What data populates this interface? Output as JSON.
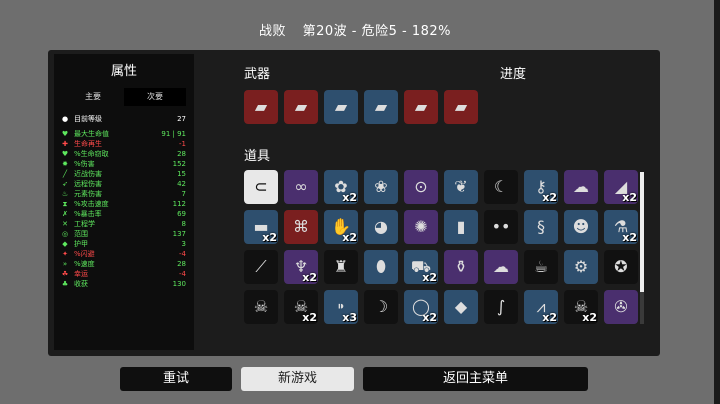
{
  "header": {
    "result": "战败",
    "wave": "第20波 - 危险5 - 182%"
  },
  "stats": {
    "title": "属性",
    "tabs": [
      "主要",
      "次要"
    ],
    "rows": [
      {
        "icon": "level-icon",
        "glyph": "●",
        "name": "目前等级",
        "value": "27",
        "color": "#ffffff"
      },
      {
        "icon": "heart-icon",
        "glyph": "♥",
        "name": "最大生命值",
        "value": "91 | 91",
        "color": "#5ee85e"
      },
      {
        "icon": "regen-icon",
        "glyph": "✚",
        "name": "生命再生",
        "value": "-1",
        "color": "#ff4a4a"
      },
      {
        "icon": "lifesteal-icon",
        "glyph": "♥",
        "name": "%生命窃取",
        "value": "28",
        "color": "#5ee85e"
      },
      {
        "icon": "damage-icon",
        "glyph": "✸",
        "name": "%伤害",
        "value": "152",
        "color": "#5ee85e"
      },
      {
        "icon": "melee-icon",
        "glyph": "╱",
        "name": "近战伤害",
        "value": "15",
        "color": "#5ee85e"
      },
      {
        "icon": "ranged-icon",
        "glyph": "➶",
        "name": "远程伤害",
        "value": "42",
        "color": "#5ee85e"
      },
      {
        "icon": "elemental-icon",
        "glyph": "♨",
        "name": "元素伤害",
        "value": "7",
        "color": "#5ee85e"
      },
      {
        "icon": "attack-speed-icon",
        "glyph": "⧗",
        "name": "%攻击速度",
        "value": "112",
        "color": "#5ee85e"
      },
      {
        "icon": "crit-icon",
        "glyph": "✗",
        "name": "%暴击率",
        "value": "69",
        "color": "#5ee85e"
      },
      {
        "icon": "engineering-icon",
        "glyph": "✕",
        "name": "工程学",
        "value": "8",
        "color": "#5ee85e"
      },
      {
        "icon": "range-icon",
        "glyph": "◎",
        "name": "范围",
        "value": "137",
        "color": "#5ee85e"
      },
      {
        "icon": "armor-icon",
        "glyph": "◆",
        "name": "护甲",
        "value": "3",
        "color": "#5ee85e"
      },
      {
        "icon": "dodge-icon",
        "glyph": "✦",
        "name": "%闪避",
        "value": "-4",
        "color": "#ff4a4a"
      },
      {
        "icon": "speed-icon",
        "glyph": "»",
        "name": "%速度",
        "value": "28",
        "color": "#5ee85e"
      },
      {
        "icon": "luck-icon",
        "glyph": "☘",
        "name": "幸运",
        "value": "-4",
        "color": "#ff4a4a"
      },
      {
        "icon": "harvest-icon",
        "glyph": "♣",
        "name": "收获",
        "value": "130",
        "color": "#5ee85e"
      }
    ]
  },
  "weapons": {
    "label": "武器",
    "items": [
      {
        "name": "weapon-pistol-icon",
        "glyph": "▰",
        "bg": "#7a1f1f"
      },
      {
        "name": "weapon-pistol-icon",
        "glyph": "▰",
        "bg": "#7a1f1f"
      },
      {
        "name": "weapon-pistol-icon",
        "glyph": "▰",
        "bg": "#2e4f6e"
      },
      {
        "name": "weapon-pistol-icon",
        "glyph": "▰",
        "bg": "#2e4f6e"
      },
      {
        "name": "weapon-pistol-icon",
        "glyph": "▰",
        "bg": "#7a1f1f"
      },
      {
        "name": "weapon-pistol-icon",
        "glyph": "▰",
        "bg": "#7a1f1f"
      }
    ]
  },
  "progress": {
    "label": "进度"
  },
  "items": {
    "label": "道具",
    "rows": [
      [
        {
          "name": "ring-item-icon",
          "glyph": "⊂",
          "bg": "#e8e8e8",
          "qty": ""
        },
        {
          "name": "handcuffs-item-icon",
          "glyph": "∞",
          "bg": "#4a2f6e",
          "qty": ""
        },
        {
          "name": "wings-item-icon",
          "glyph": "✿",
          "bg": "#2e4f6e",
          "qty": "x2"
        },
        {
          "name": "bunny-item-icon",
          "glyph": "❀",
          "bg": "#2e4f6e",
          "qty": ""
        },
        {
          "name": "cannon-item-icon",
          "glyph": "⊙",
          "bg": "#4a2f6e",
          "qty": ""
        },
        {
          "name": "feather-item-icon",
          "glyph": "❦",
          "bg": "#2e4f6e",
          "qty": ""
        },
        {
          "name": "scythe-item-icon",
          "glyph": "☾",
          "bg": "#111111",
          "qty": ""
        },
        {
          "name": "key-item-icon",
          "glyph": "⚷",
          "bg": "#2e4f6e",
          "qty": "x2"
        },
        {
          "name": "ghost-item-icon",
          "glyph": "☁",
          "bg": "#4a2f6e",
          "qty": ""
        },
        {
          "name": "fin-item-icon",
          "glyph": "◢",
          "bg": "#4a2f6e",
          "qty": "x2"
        }
      ],
      [
        {
          "name": "cloth-item-icon",
          "glyph": "▬",
          "bg": "#2e4f6e",
          "qty": "x2"
        },
        {
          "name": "robot-item-icon",
          "glyph": "⌘",
          "bg": "#7a1f1f",
          "qty": ""
        },
        {
          "name": "claw-item-icon",
          "glyph": "✋",
          "bg": "#2e4f6e",
          "qty": "x2"
        },
        {
          "name": "pig-item-icon",
          "glyph": "◕",
          "bg": "#2e4f6e",
          "qty": ""
        },
        {
          "name": "octopus-item-icon",
          "glyph": "✺",
          "bg": "#4a2f6e",
          "qty": ""
        },
        {
          "name": "spray-item-icon",
          "glyph": "▮",
          "bg": "#2e4f6e",
          "qty": ""
        },
        {
          "name": "eyes-item-icon",
          "glyph": "••",
          "bg": "#111111",
          "qty": ""
        },
        {
          "name": "worm-item-icon",
          "glyph": "§",
          "bg": "#2e4f6e",
          "qty": ""
        },
        {
          "name": "zombie-item-icon",
          "glyph": "☻",
          "bg": "#2e4f6e",
          "qty": ""
        },
        {
          "name": "potion-item-icon",
          "glyph": "⚗",
          "bg": "#2e4f6e",
          "qty": "x2"
        }
      ],
      [
        {
          "name": "syringe-item-icon",
          "glyph": "⟋",
          "bg": "#111111",
          "qty": ""
        },
        {
          "name": "torch-item-icon",
          "glyph": "♆",
          "bg": "#4a2f6e",
          "qty": "x2"
        },
        {
          "name": "statue-item-icon",
          "glyph": "♜",
          "bg": "#111111",
          "qty": ""
        },
        {
          "name": "stone-item-icon",
          "glyph": "⬮",
          "bg": "#2e4f6e",
          "qty": ""
        },
        {
          "name": "tractor-item-icon",
          "glyph": "⛟",
          "bg": "#2e4f6e",
          "qty": "x2"
        },
        {
          "name": "flask-item-icon",
          "glyph": "⚱",
          "bg": "#4a2f6e",
          "qty": ""
        },
        {
          "name": "sheep-item-icon",
          "glyph": "☁",
          "bg": "#4a2f6e",
          "qty": ""
        },
        {
          "name": "coffee-item-icon",
          "glyph": "☕",
          "bg": "#111111",
          "qty": ""
        },
        {
          "name": "turret-item-icon",
          "glyph": "⚙",
          "bg": "#2e4f6e",
          "qty": ""
        },
        {
          "name": "dog-item-icon",
          "glyph": "✪",
          "bg": "#111111",
          "qty": ""
        }
      ],
      [
        {
          "name": "skull-banner-item-icon",
          "glyph": "☠",
          "bg": "#111111",
          "qty": ""
        },
        {
          "name": "bones-item-icon",
          "glyph": "☠",
          "bg": "#111111",
          "qty": "x2"
        },
        {
          "name": "bullet-item-icon",
          "glyph": "⁍",
          "bg": "#2e4f6e",
          "qty": "x3"
        },
        {
          "name": "horn-item-icon",
          "glyph": "☽",
          "bg": "#111111",
          "qty": ""
        },
        {
          "name": "amulet-item-icon",
          "glyph": "◯",
          "bg": "#2e4f6e",
          "qty": "x2"
        },
        {
          "name": "eraser-item-icon",
          "glyph": "◆",
          "bg": "#2e4f6e",
          "qty": ""
        },
        {
          "name": "snake-item-icon",
          "glyph": "∫",
          "bg": "#111111",
          "qty": ""
        },
        {
          "name": "claws-item-icon",
          "glyph": "⩘",
          "bg": "#2e4f6e",
          "qty": "x2"
        },
        {
          "name": "skull-item-icon",
          "glyph": "☠",
          "bg": "#111111",
          "qty": "x2"
        },
        {
          "name": "grinder-item-icon",
          "glyph": "✇",
          "bg": "#4a2f6e",
          "qty": ""
        }
      ]
    ]
  },
  "buttons": {
    "retry": "重试",
    "new_game": "新游戏",
    "main_menu": "返回主菜单"
  }
}
